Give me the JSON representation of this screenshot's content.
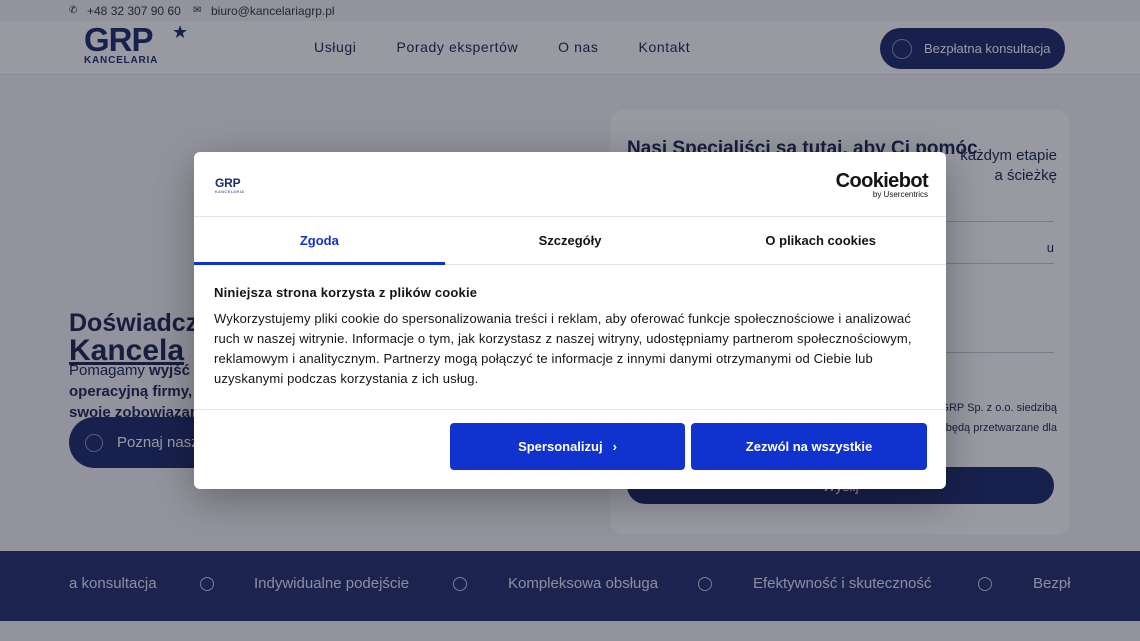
{
  "topbar": {
    "phone": "+48 32 307 90 60",
    "email": "biuro@kancelariagrp.pl",
    "phone_icon": "phone-icon",
    "email_icon": "mail-icon"
  },
  "header": {
    "logo_text": "GRP",
    "logo_sub": "KANCELARIA",
    "nav": [
      "Usługi",
      "Porady ekspertów",
      "O nas",
      "Kontakt"
    ],
    "cta_label": "Bezpłatna konsultacja"
  },
  "hero": {
    "title_line1": "Doświadcz",
    "title_line2": "Kancela",
    "text_prefix": "Pomagamy ",
    "text_bold1": "wyjść",
    "text_line2": "operacyjną firmy,",
    "text_line3": "swoje zobowiązan",
    "button_label": "Poznaj nasz"
  },
  "form": {
    "title": "Nasi Specjaliści są tutaj, aby Ci pomóc",
    "desc_line1": "każdym etapie",
    "desc_line2": "a ścieżkę",
    "field_hint": "u",
    "consent_line1": "GRP Sp. z o.o. siedzibą",
    "consent_line2": "będą przetwarzane dla",
    "submit_label": "Wyślij"
  },
  "band": {
    "items": [
      "a konsultacja",
      "Indywidualne podejście",
      "Kompleksowa obsługa",
      "Efektywność i skuteczność",
      "Bezpł"
    ]
  },
  "cookie_dialog": {
    "logo_text": "GRP",
    "logo_sub": "KANCELARIA",
    "brand": "Cookiebot",
    "brand_sub": "by Usercentrics",
    "tabs": [
      "Zgoda",
      "Szczegóły",
      "O plikach cookies"
    ],
    "active_tab": "Zgoda",
    "heading": "Niniejsza strona korzysta z plików cookie",
    "body": "Wykorzystujemy pliki cookie do spersonalizowania treści i reklam, aby oferować funkcje społecznościowe i analizować ruch w naszej witrynie. Informacje o tym, jak korzystasz z naszej witryny, udostępniamy partnerom społecznościowym, reklamowym i analitycznym. Partnerzy mogą połączyć te informacje z innymi danymi otrzymanymi od Ciebie lub uzyskanymi podczas korzystania z ich usług.",
    "customize_label": "Spersonalizuj",
    "allow_all_label": "Zezwól na wszystkie",
    "accent_color": "#1032cf"
  }
}
